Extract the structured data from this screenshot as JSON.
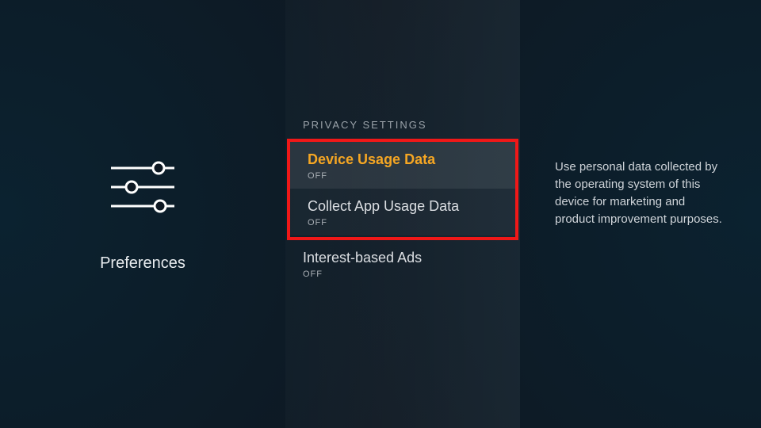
{
  "left": {
    "title": "Preferences"
  },
  "mid": {
    "header": "PRIVACY SETTINGS",
    "items": [
      {
        "title": "Device Usage Data",
        "sub": "OFF"
      },
      {
        "title": "Collect App Usage Data",
        "sub": "OFF"
      },
      {
        "title": "Interest-based Ads",
        "sub": "OFF"
      }
    ]
  },
  "right": {
    "description": "Use personal data collected by the operating system of this device for marketing and product improvement purposes."
  }
}
